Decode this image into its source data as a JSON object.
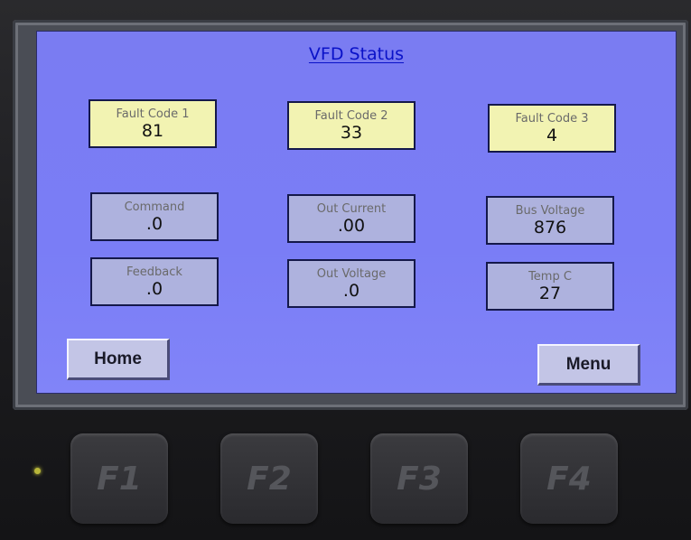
{
  "screen": {
    "title": "VFD Status",
    "faults": [
      {
        "label": "Fault Code 1",
        "value": "81"
      },
      {
        "label": "Fault Code 2",
        "value": "33"
      },
      {
        "label": "Fault Code 3",
        "value": "4"
      }
    ],
    "measurements": {
      "command": {
        "label": "Command",
        "value": ".0"
      },
      "out_current": {
        "label": "Out Current",
        "value": ".00"
      },
      "bus_voltage": {
        "label": "Bus Voltage",
        "value": "876"
      },
      "feedback": {
        "label": "Feedback",
        "value": ".0"
      },
      "out_voltage": {
        "label": "Out Voltage",
        "value": ".0"
      },
      "temp": {
        "label": "Temp C",
        "value": "27"
      }
    },
    "buttons": {
      "home": "Home",
      "menu": "Menu"
    }
  },
  "function_keys": [
    "F1",
    "F2",
    "F3",
    "F4"
  ],
  "colors": {
    "screen_bg": "#7a7cf2",
    "fault_box": "#f2f3b2",
    "measure_box": "#aeb2de",
    "title": "#0a12c8"
  }
}
